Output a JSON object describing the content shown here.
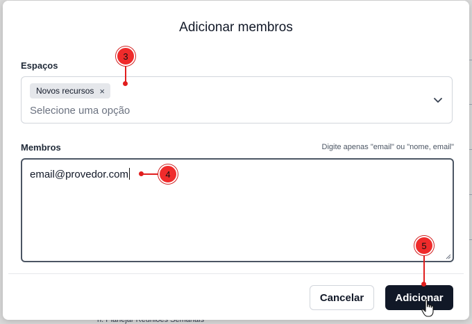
{
  "dialog": {
    "title": "Adicionar membros",
    "spaces": {
      "label": "Espaços",
      "selected_chips": [
        "Novos recursos"
      ],
      "chip_remove_glyph": "×",
      "placeholder": "Selecione uma opção"
    },
    "members": {
      "label": "Membros",
      "hint": "Digite apenas \"email\" ou \"nome, email\"",
      "value": "email@provedor.com"
    },
    "buttons": {
      "cancel": "Cancelar",
      "submit": "Adicionar"
    }
  },
  "annotations": [
    "3",
    "4",
    "5"
  ],
  "background_text": [
    "n. Planejar Reuniões Semanais"
  ],
  "colors": {
    "primary_button": "#111827",
    "annotation_red": "#ef2b2b",
    "backdrop": "#d9d9d9"
  },
  "icons": [
    "chevron-down-icon",
    "chip-remove-icon",
    "hand-pointer-icon",
    "resize-grip-icon"
  ]
}
